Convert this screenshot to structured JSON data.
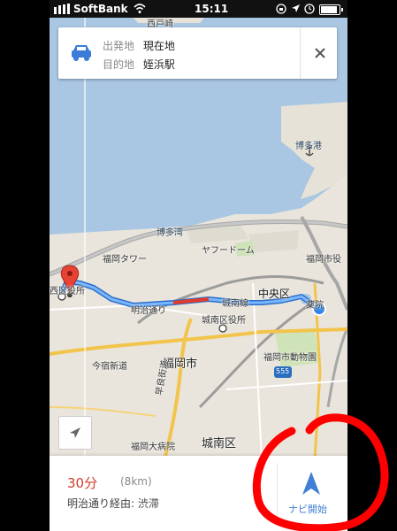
{
  "status_bar": {
    "carrier": "SoftBank",
    "time": "15:11",
    "battery_level": 0.8
  },
  "route_card": {
    "origin_label": "出発地",
    "origin_value": "現在地",
    "destination_label": "目的地",
    "destination_value": "姪浜駅",
    "close_icon": "close-icon",
    "mode_icon": "car-icon"
  },
  "map": {
    "labels": {
      "partial_top": "西戸崎",
      "hakata_port": "博多港",
      "hakata_bay": "博多湾",
      "fukuoka_tower": "福岡タワー",
      "yahoo_dome": "ヤフードーム",
      "city_hall": "福岡市役",
      "ward_office_partial": "西区役所",
      "meiji_street": "明治通り",
      "kannan_line": "城南線",
      "chuo_ward": "中央区",
      "yakuin": "薬院",
      "jonan_ward_office": "城南区役所",
      "imajuku_road": "今宿新道",
      "fukuoka_city": "福岡市",
      "zoo": "福岡市動物園",
      "route_555": "555",
      "sawara_road": "早良街道",
      "university_hospital": "福岡大病院",
      "jonan_ward": "城南区"
    },
    "colors": {
      "water": "#a9c7e2",
      "land": "#e9e5dc",
      "route": "#4a8fe7",
      "congestion": "#e03b2b"
    }
  },
  "bottom_panel": {
    "duration": "30分",
    "distance": "(8km)",
    "via": "明治通り経由: 渋滞",
    "nav_button_label": "ナビ開始"
  },
  "annotation_color": "#ff0000"
}
